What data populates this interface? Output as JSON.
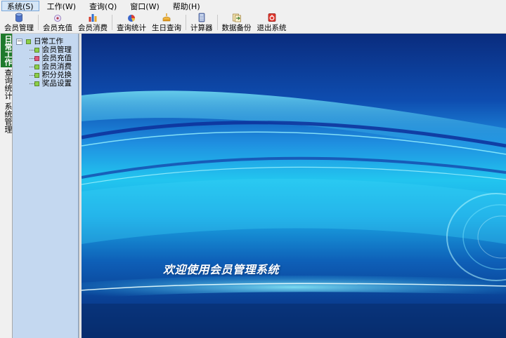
{
  "menu": {
    "items": [
      {
        "label": "系统(S)",
        "active": true
      },
      {
        "label": "工作(W)",
        "active": false
      },
      {
        "label": "查询(Q)",
        "active": false
      },
      {
        "label": "窗口(W)",
        "active": false
      },
      {
        "label": "帮助(H)",
        "active": false
      }
    ]
  },
  "toolbar": {
    "member_manage": "会员管理",
    "member_recharge": "会员充值",
    "member_consume": "会员消费",
    "query_stats": "查询统计",
    "birthday_query": "生日查询",
    "calculator": "计算器",
    "data_backup": "数据备份",
    "exit_system": "退出系统"
  },
  "vtabs": {
    "daily_work": "日常工作",
    "query_stats": "查询统计",
    "system_manage": "系统管理"
  },
  "tree": {
    "root": "日常工作",
    "expander": "−",
    "children": [
      "会员管理",
      "会员充值",
      "会员消费",
      "积分兑换",
      "奖品设置"
    ]
  },
  "banner": {
    "welcome": "欢迎使用会员管理系统"
  },
  "colors": {
    "active_tab": "#1f7a2c",
    "tree_bg": "#c4d8f0",
    "menu_active": "#d5e6f7"
  }
}
